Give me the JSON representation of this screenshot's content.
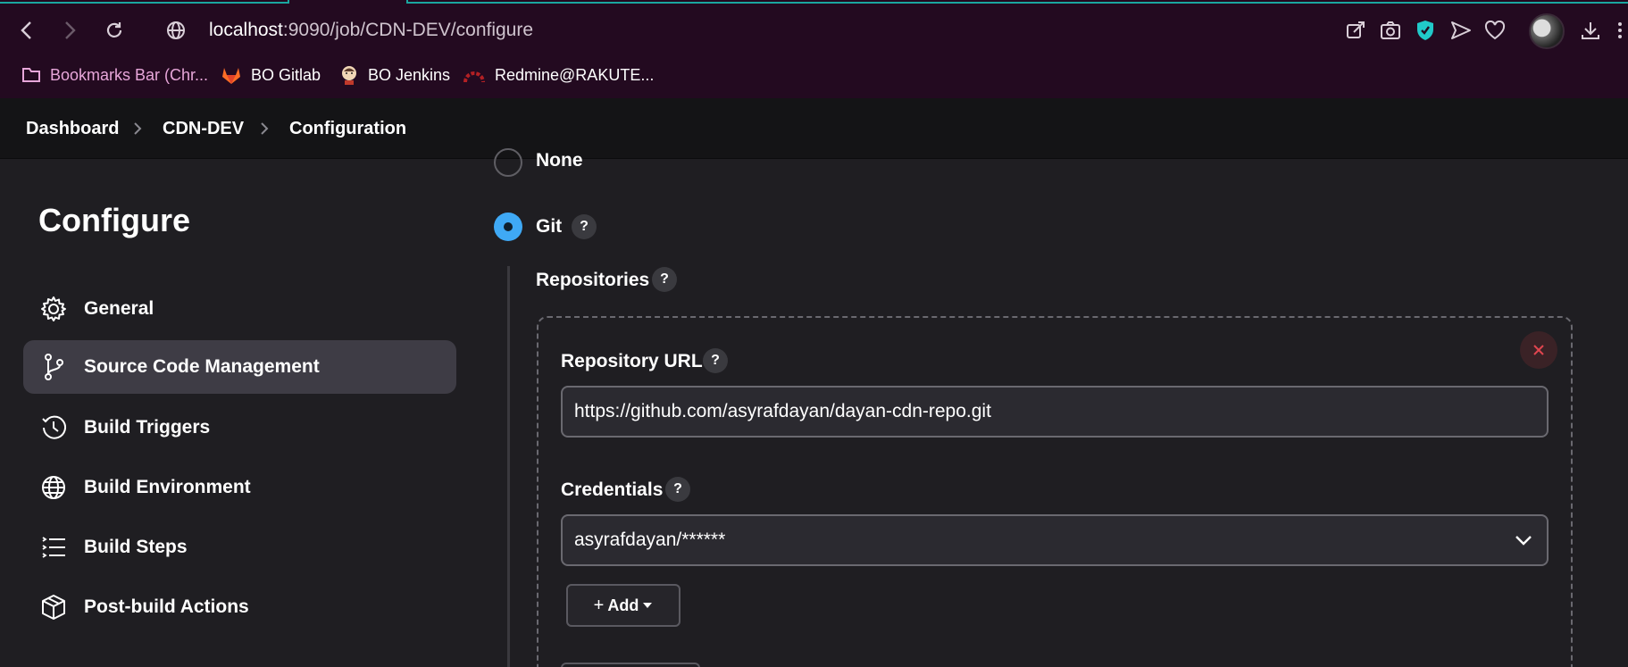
{
  "browser": {
    "url_host": "localhost",
    "url_path": ":9090/job/CDN-DEV/configure",
    "bookmarks": [
      {
        "label": "Bookmarks Bar (Chr..."
      },
      {
        "label": "BO Gitlab"
      },
      {
        "label": "BO Jenkins"
      },
      {
        "label": "Redmine@RAKUTE..."
      }
    ]
  },
  "breadcrumb": [
    "Dashboard",
    "CDN-DEV",
    "Configuration"
  ],
  "sidebar": {
    "title": "Configure",
    "items": [
      {
        "label": "General",
        "icon": "gear-icon"
      },
      {
        "label": "Source Code Management",
        "icon": "branch-icon",
        "active": true
      },
      {
        "label": "Build Triggers",
        "icon": "clock-icon"
      },
      {
        "label": "Build Environment",
        "icon": "globe-icon"
      },
      {
        "label": "Build Steps",
        "icon": "list-icon"
      },
      {
        "label": "Post-build Actions",
        "icon": "package-icon"
      }
    ]
  },
  "scm": {
    "option_none": "None",
    "option_git": "Git",
    "repositories_label": "Repositories",
    "repo_url_label": "Repository URL",
    "repo_url_value": "https://github.com/asyrafdayan/dayan-cdn-repo.git",
    "credentials_label": "Credentials",
    "credentials_value": "asyrafdayan/******",
    "add_label": "Add",
    "help": "?"
  },
  "colors": {
    "chrome_bg": "#230a20",
    "page_bg": "#1f1e22",
    "accent": "#3fa9f5",
    "danger": "#e0454f"
  }
}
